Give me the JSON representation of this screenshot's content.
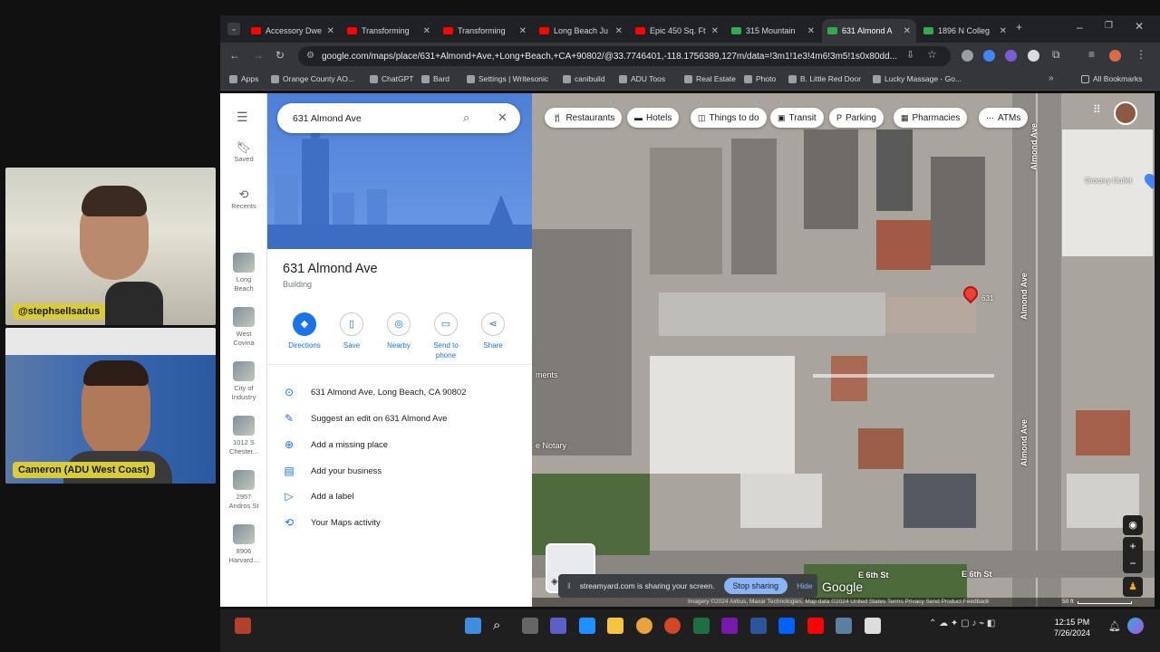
{
  "participants": [
    {
      "name": "@stephsellsadus"
    },
    {
      "name": "Cameron (ADU West Coast)"
    }
  ],
  "tabs": [
    {
      "label": "Accessory Dwe",
      "color": "#ff0000",
      "active": false
    },
    {
      "label": "Transforming",
      "color": "#ff0000",
      "active": false
    },
    {
      "label": "Transforming",
      "color": "#ff0000",
      "active": false
    },
    {
      "label": "Long Beach Ju",
      "color": "#ff0000",
      "active": false
    },
    {
      "label": "Epic 450 Sq. Ft",
      "color": "#ff0000",
      "active": false
    },
    {
      "label": "315 Mountain",
      "color": "#34a853",
      "active": false
    },
    {
      "label": "631 Almond A",
      "color": "#34a853",
      "active": true
    },
    {
      "label": "1896 N Colleg",
      "color": "#34a853",
      "active": false
    }
  ],
  "address_bar": {
    "url": "google.com/maps/place/631+Almond+Ave,+Long+Beach,+CA+90802/@33.7746401,-118.1756389,127m/data=!3m1!1e3!4m6!3m5!1s0x80dd..."
  },
  "bookmarks": [
    "Apps",
    "Orange County AO...",
    "ChatGPT",
    "Bard",
    "Settings | Writesonic",
    "canibuild",
    "ADU Toos",
    "Real Estate",
    "Photo",
    "B. Little Red Door",
    "Lucky Massage - Go..."
  ],
  "all_bookmarks": "All Bookmarks",
  "rail": {
    "saved": "Saved",
    "recents": "Recents",
    "places": [
      [
        "Long",
        "Beach"
      ],
      [
        "West",
        "Covina"
      ],
      [
        "City of",
        "Industry"
      ],
      [
        "1012 S",
        "Chester..."
      ],
      [
        "2957",
        "Andros St"
      ],
      [
        "8906",
        "Harvard..."
      ]
    ]
  },
  "search": {
    "value": "631 Almond Ave"
  },
  "place": {
    "title": "631 Almond Ave",
    "subtitle": "Building"
  },
  "actions": [
    "Directions",
    "Save",
    "Nearby",
    "Send to phone",
    "Share"
  ],
  "info_rows": [
    "631 Almond Ave, Long Beach, CA 90802",
    "Suggest an edit on 631 Almond Ave",
    "Add a missing place",
    "Add your business",
    "Add a label",
    "Your Maps activity"
  ],
  "chips": [
    "Restaurants",
    "Hotels",
    "Things to do",
    "Transit",
    "Parking",
    "Pharmacies",
    "ATMs"
  ],
  "map": {
    "streets": [
      "Almond Ave",
      "Almond Ave",
      "Almond Ave",
      "E 6th St",
      "E 6th St"
    ],
    "poi": "Grocery Outlet",
    "pin_label": "631",
    "google": "Google",
    "left_label": "ments",
    "left_label2": "e Notary",
    "attribution": "Imagery ©2024 Airbus, Maxar Technologies, Map data ©2024   United States   Terms   Privacy   Send Product Feedback",
    "scale": "50 ft"
  },
  "share_bar": {
    "message": "streamyard.com is sharing your screen.",
    "stop": "Stop sharing",
    "hide": "Hide"
  },
  "clock": {
    "time": "12:15 PM",
    "date": "7/26/2024"
  }
}
